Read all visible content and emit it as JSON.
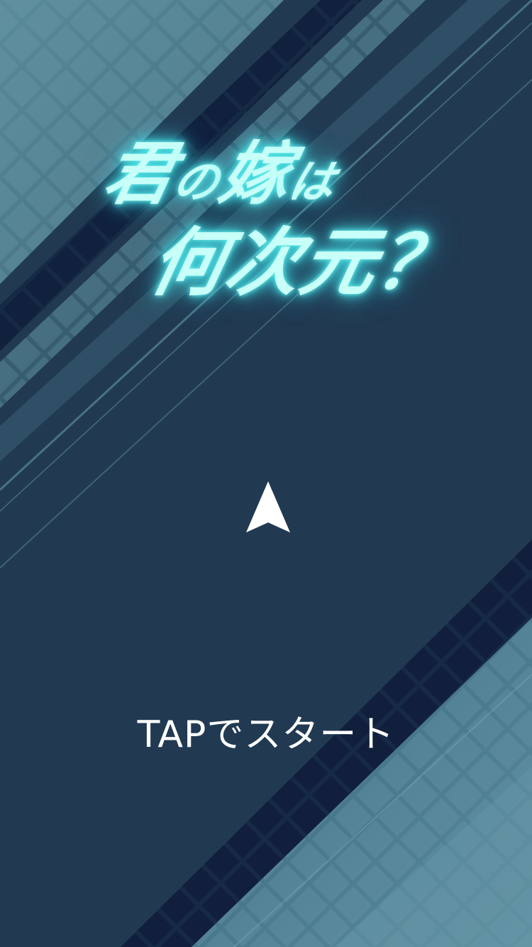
{
  "game": {
    "title_line1_parts": [
      "君",
      "の",
      "嫁",
      "は"
    ],
    "title_line2": "何次元？",
    "start_prompt": "TAPでスタート"
  },
  "player": {
    "icon": "arrow-up-icon",
    "color": "#ffffff"
  },
  "colors": {
    "background": "#213a52",
    "title_glow": "#6ff3ee",
    "title_text": "#c8fff9",
    "band_light": "#4f7f90",
    "band_dark": "#101f3c",
    "prompt_text": "#ffffff"
  }
}
